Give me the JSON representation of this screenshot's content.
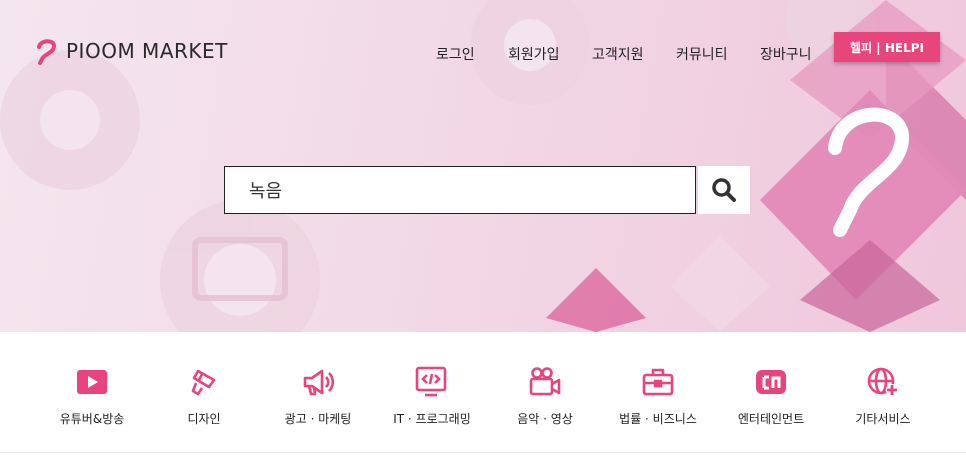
{
  "brand": {
    "name": "PIOOM MARKET"
  },
  "nav": {
    "items": [
      "로그인",
      "회원가입",
      "고객지원",
      "커뮤니티",
      "장바구니"
    ]
  },
  "helpi_button": "헬피 | HELPI",
  "search": {
    "value": "녹음"
  },
  "categories": [
    {
      "label": "유튜버&방송",
      "icon": "youtube-play-icon"
    },
    {
      "label": "디자인",
      "icon": "paintbrush-icon"
    },
    {
      "label": "광고 · 마케팅",
      "icon": "megaphone-icon"
    },
    {
      "label": "IT · 프로그래밍",
      "icon": "code-monitor-icon"
    },
    {
      "label": "음악 · 영상",
      "icon": "video-camera-icon"
    },
    {
      "label": "법률 · 비즈니스",
      "icon": "briefcase-icon"
    },
    {
      "label": "엔터테인먼트",
      "icon": "entertainment-icon"
    },
    {
      "label": "기타서비스",
      "icon": "globe-plus-icon"
    }
  ],
  "colors": {
    "accent": "#e8457c",
    "hero_bg": "#f2d9e6",
    "icon": "#e8457c"
  }
}
